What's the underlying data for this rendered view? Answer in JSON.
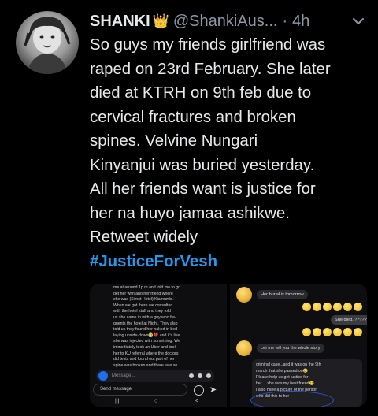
{
  "tweet": {
    "display_name": "SHANKI",
    "crown_icon": "crown-emoji",
    "handle": "@ShankiAus...",
    "separator": "·",
    "time": "4h",
    "body_lines": [
      "So guys my friends girlfriend was",
      "raped on 23rd February. She later",
      "died at KTRH on 9th feb due to",
      "cervical fractures and broken",
      "spines.   Velvine Nungari",
      "Kinyanjui was buried yesterday.",
      "All her friends want is justice for",
      "her na huyo jamaa ashikwe.",
      "Retweet widely"
    ],
    "hashtag": "#JusticeForVesh",
    "hashtag_color": "#1d9bf0"
  },
  "media_left": {
    "chat_lines": [
      "me at around 1p.m and told me to go",
      "get her with another friend where",
      "she was (Simot Hotel) Kiamumbi.",
      "When we got there we consulted",
      "with the hotel staff and they told",
      "us she came in with a guy who fre-",
      "quents the hotel at Night. They also",
      "told us they found her naked in bed",
      "laying upside-down😭💔 and it's like",
      "she was injected with something. We",
      "immediately took an Uber and took",
      "her to KU referral where the doctors",
      "did tests and found out part of her",
      "spine was broken and there was so"
    ],
    "message_placeholder": "Message...",
    "send_placeholder": "Send message",
    "nav": [
      "|||",
      "○",
      "<"
    ]
  },
  "media_right": {
    "burial_msg": "Her burial is tomorrow",
    "dead_msg": "She died..?????",
    "whole_story_msg": "Let me tell you the whole story",
    "card_lines": [
      "criminal case...and it was on the 9th",
      "march that she passed on😢",
      "",
      "Please help us get justice for",
      "her.... she was my best friend😢...",
      "",
      "I also have a picture of the person",
      "who did this to her"
    ]
  },
  "colors": {
    "background": "#000000",
    "text": "#e7e9ea",
    "muted": "#8b98a5",
    "accent": "#1d9bf0",
    "circle_annotation": "#2b55d8"
  }
}
